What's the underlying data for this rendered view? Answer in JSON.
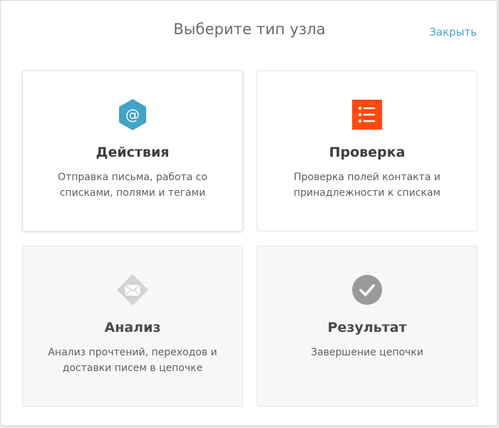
{
  "dialog": {
    "title": "Выберите тип узла",
    "close_label": "Закрыть"
  },
  "cards": [
    {
      "title": "Действия",
      "description": "Отправка письма, работа со списками, полями и тегами",
      "icon": "at-sign-hexagon-icon",
      "color": "#42a3c6"
    },
    {
      "title": "Проверка",
      "description": "Проверка полей контакта и принадлежности к спискам",
      "icon": "checklist-icon",
      "color": "#ff4a11"
    },
    {
      "title": "Анализ",
      "description": "Анализ прочтений, переходов и доставки писем в цепочке",
      "icon": "envelope-diamond-icon",
      "color": "#d3d3d3"
    },
    {
      "title": "Результат",
      "description": "Завершение цепочки",
      "icon": "checkmark-circle-icon",
      "color": "#9a9a9a"
    }
  ]
}
